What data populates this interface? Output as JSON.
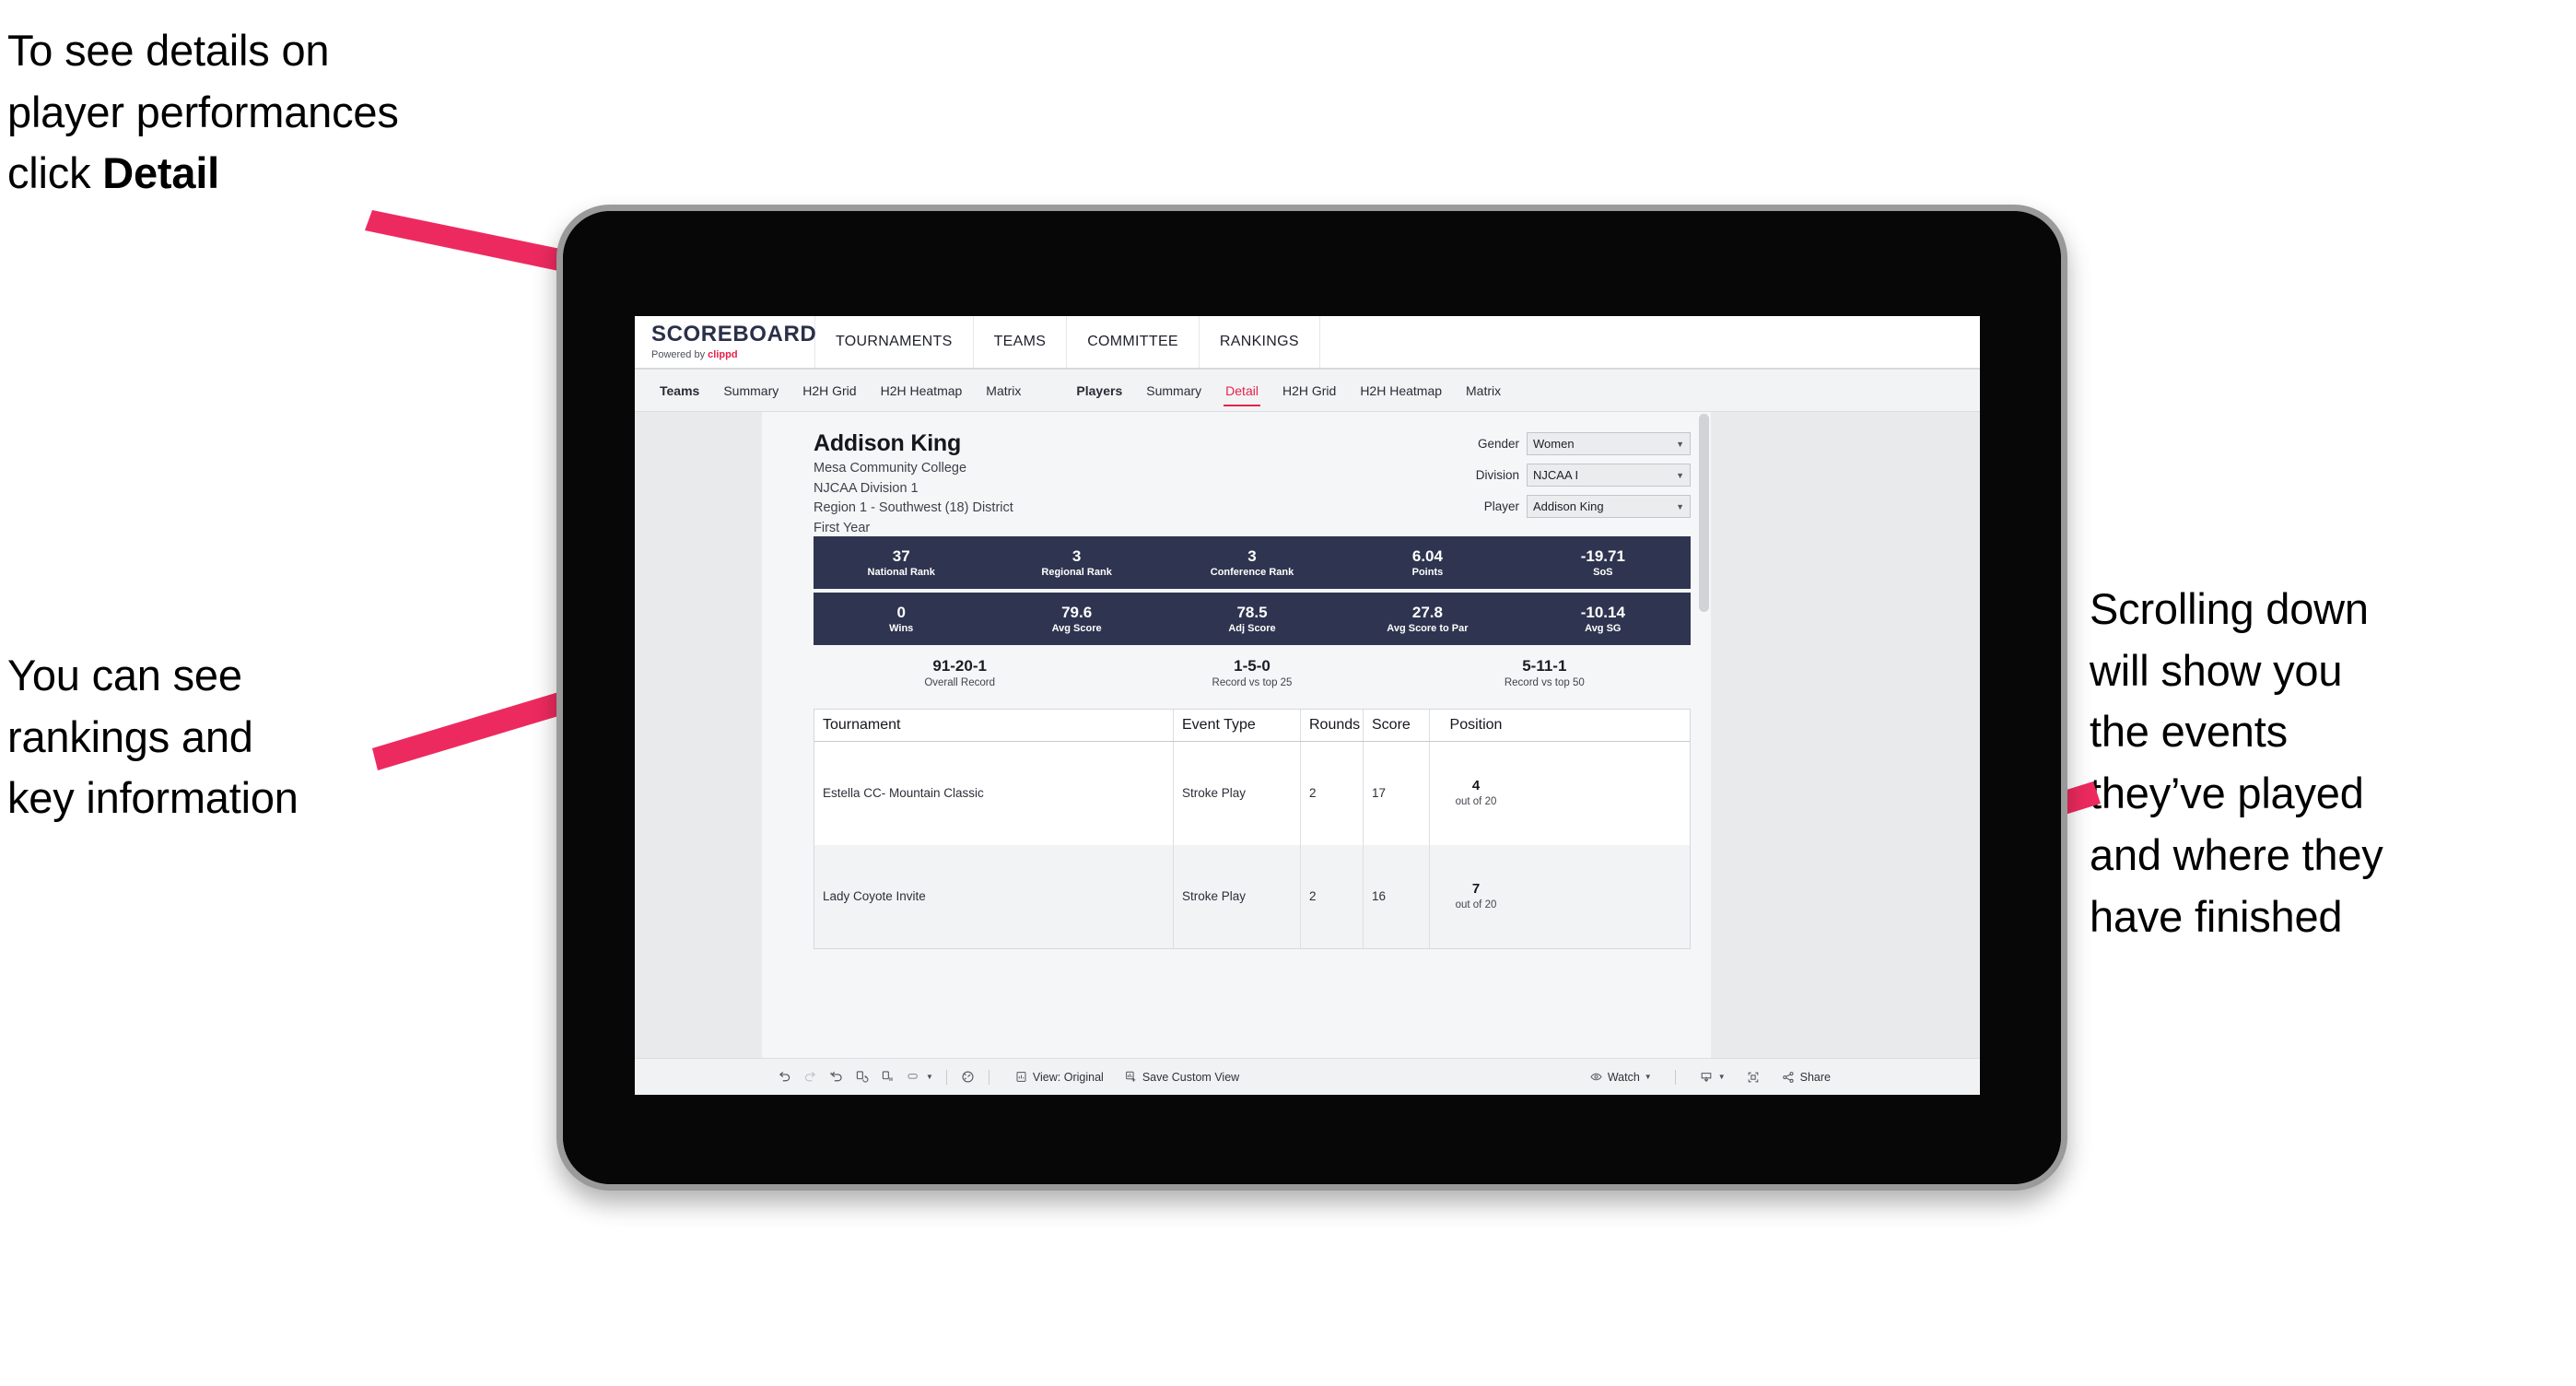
{
  "annotations": {
    "top_left": "To see details on\nplayer performances\nclick ",
    "top_left_bold": "Detail",
    "left": "You can see\nrankings and\nkey information",
    "right": "Scrolling down\nwill show you\nthe events\nthey’ve played\nand where they\nhave finished",
    "arrow_color": "#ED2A5F"
  },
  "app": {
    "brand": {
      "title": "SCOREBOARD",
      "powered_prefix": "Powered by ",
      "powered_name": "clippd"
    },
    "top_nav": [
      "TOURNAMENTS",
      "TEAMS",
      "COMMITTEE",
      "RANKINGS"
    ],
    "sub_nav": {
      "teams_group": [
        "Teams",
        "Summary",
        "H2H Grid",
        "H2H Heatmap",
        "Matrix"
      ],
      "players_group": [
        "Players",
        "Summary",
        "Detail",
        "H2H Grid",
        "H2H Heatmap",
        "Matrix"
      ],
      "active_tab": "Detail"
    }
  },
  "player": {
    "name": "Addison King",
    "school": "Mesa Community College",
    "division": "NJCAA Division 1",
    "region": "Region 1 - Southwest (18) District",
    "year": "First Year"
  },
  "selectors": [
    {
      "label": "Gender",
      "value": "Women"
    },
    {
      "label": "Division",
      "value": "NJCAA I"
    },
    {
      "label": "Player",
      "value": "Addison King"
    }
  ],
  "stats_row_1": [
    {
      "value": "37",
      "label": "National Rank"
    },
    {
      "value": "3",
      "label": "Regional Rank"
    },
    {
      "value": "3",
      "label": "Conference Rank"
    },
    {
      "value": "6.04",
      "label": "Points"
    },
    {
      "value": "-19.71",
      "label": "SoS"
    }
  ],
  "stats_row_2": [
    {
      "value": "0",
      "label": "Wins"
    },
    {
      "value": "79.6",
      "label": "Avg Score"
    },
    {
      "value": "78.5",
      "label": "Adj Score"
    },
    {
      "value": "27.8",
      "label": "Avg Score to Par"
    },
    {
      "value": "-10.14",
      "label": "Avg SG"
    }
  ],
  "records": [
    {
      "value": "91-20-1",
      "label": "Overall Record"
    },
    {
      "value": "1-5-0",
      "label": "Record vs top 25"
    },
    {
      "value": "5-11-1",
      "label": "Record vs top 50"
    }
  ],
  "table": {
    "headers": [
      "Tournament",
      "Event Type",
      "Rounds",
      "Score",
      "Position"
    ],
    "rows": [
      {
        "tournament": "Estella CC- Mountain Classic",
        "event_type": "Stroke Play",
        "rounds": "2",
        "score": "17",
        "position_value": "4",
        "position_sub": "out of 20"
      },
      {
        "tournament": "Lady Coyote Invite",
        "event_type": "Stroke Play",
        "rounds": "2",
        "score": "16",
        "position_value": "7",
        "position_sub": "out of 20"
      }
    ]
  },
  "toolbar": {
    "view_label": "View: Original",
    "save_label": "Save Custom View",
    "watch_label": "Watch",
    "share_label": "Share"
  },
  "colors": {
    "accent_pink": "#E6224A",
    "stat_bar": "#2F3550",
    "brand_navy": "#2B3049"
  }
}
